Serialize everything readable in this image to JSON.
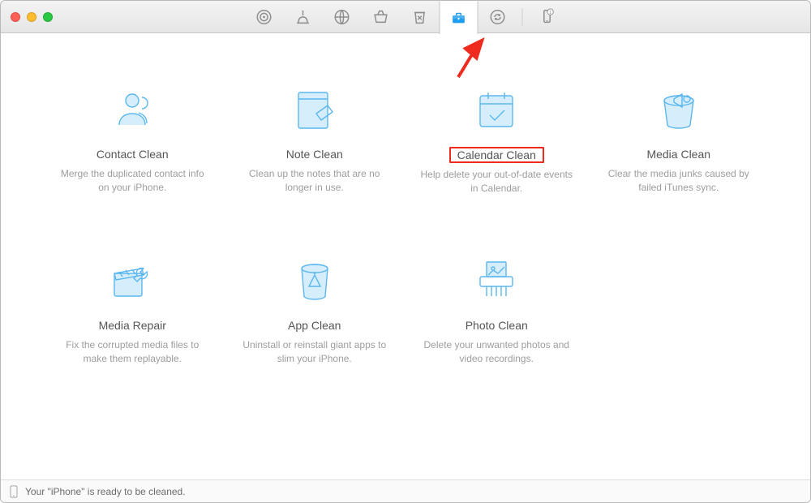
{
  "toolbar": {
    "tabs": [
      {
        "name": "target"
      },
      {
        "name": "clean"
      },
      {
        "name": "globe"
      },
      {
        "name": "basket"
      },
      {
        "name": "recycle"
      },
      {
        "name": "toolbox",
        "active": true
      },
      {
        "name": "circle-refresh"
      }
    ],
    "device_badge": "1"
  },
  "tools": [
    {
      "key": "contact",
      "title": "Contact Clean",
      "desc": "Merge the duplicated contact info on your iPhone."
    },
    {
      "key": "note",
      "title": "Note Clean",
      "desc": "Clean up the notes that are no longer in use."
    },
    {
      "key": "calendar",
      "title": "Calendar Clean",
      "desc": "Help delete your out-of-date events in Calendar.",
      "highlighted": true
    },
    {
      "key": "media-clean",
      "title": "Media Clean",
      "desc": "Clear the media junks caused by failed iTunes sync."
    },
    {
      "key": "media-repair",
      "title": "Media Repair",
      "desc": "Fix the corrupted media files to make them replayable."
    },
    {
      "key": "app",
      "title": "App Clean",
      "desc": "Uninstall or reinstall giant apps to slim your iPhone."
    },
    {
      "key": "photo",
      "title": "Photo Clean",
      "desc": "Delete your unwanted photos and video recordings."
    }
  ],
  "status": {
    "text": "Your \"iPhone\" is ready to be cleaned."
  },
  "annotations": {
    "arrow_points_to_tab": "toolbox"
  }
}
